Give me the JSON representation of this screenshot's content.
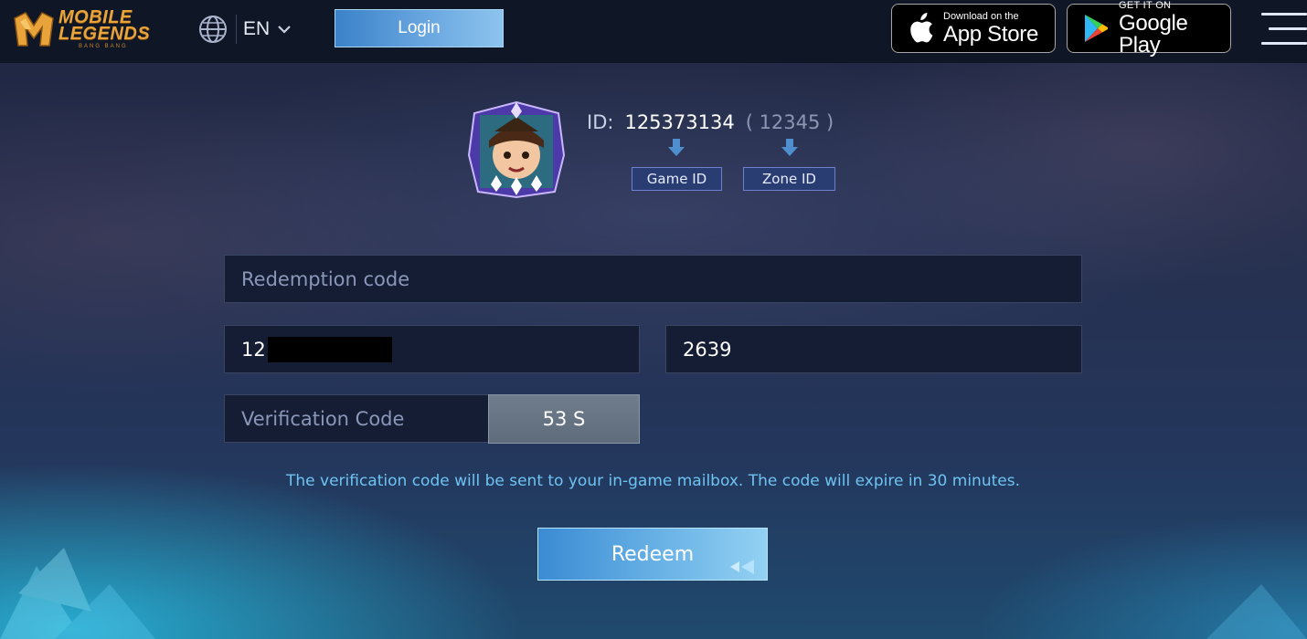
{
  "header": {
    "logo_text_line1": "MOBILE",
    "logo_text_line2": "LEGENDS",
    "logo_sub": "BANG BANG",
    "language": "EN",
    "login_label": "Login",
    "app_store": {
      "small": "Download on the",
      "big": "App Store"
    },
    "google_play": {
      "small": "GET IT ON",
      "big": "Google Play"
    }
  },
  "profile": {
    "id_label": "ID:",
    "game_id": "125373134",
    "zone_id": "( 12345 )",
    "game_id_tag": "Game ID",
    "zone_id_tag": "Zone ID"
  },
  "form": {
    "redemption_placeholder": "Redemption code",
    "game_id_value": "12",
    "zone_id_value": "2639",
    "verification_placeholder": "Verification Code",
    "countdown_label": "53 S",
    "helper_text": "The verification code will be sent to your in-game mailbox. The code will expire in 30 minutes.",
    "redeem_label": "Redeem"
  },
  "colors": {
    "header_bg": "#0f1626",
    "accent_blue": "#6aa7e0",
    "helper_text": "#6fc3f2",
    "field_bg": "#141d33",
    "logo_gold": "#e8a43a"
  },
  "icons": [
    "globe-icon",
    "chevron-down-icon",
    "apple-icon",
    "google-play-icon",
    "hamburger-menu-icon",
    "arrow-down-icon"
  ]
}
